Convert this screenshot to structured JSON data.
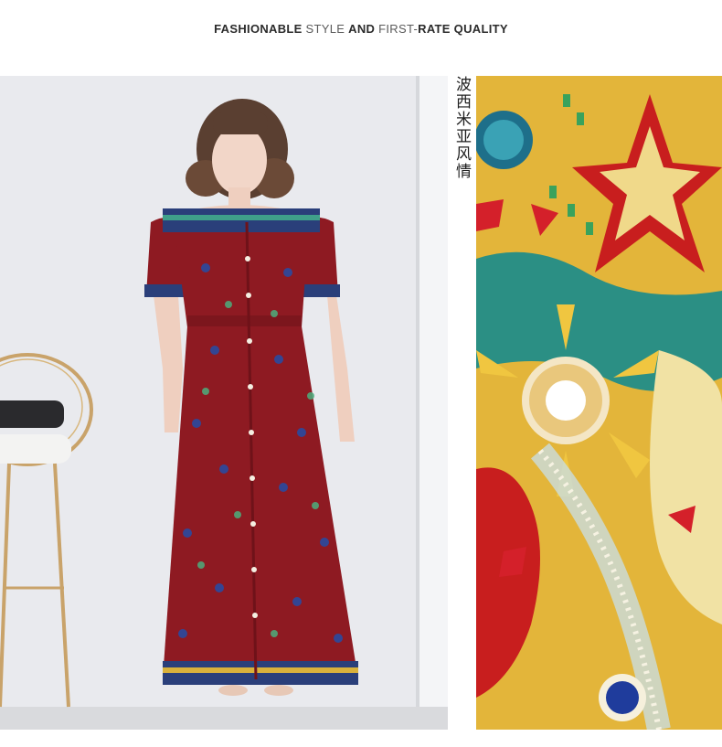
{
  "headline": {
    "part1": "FASHIONABLE",
    "part2": " STYLE ",
    "part3": "AND",
    "part4": " FIRST-",
    "part5": "RATE QUALITY"
  },
  "caption": "波西米亚风情",
  "images": {
    "left": "model-in-red-off-shoulder-maxi-dress",
    "right": "mosaic-tile-artwork"
  },
  "colors": {
    "dress_red": "#8e1a22",
    "dress_trim_blue": "#2a3f7a",
    "mosaic_gold": "#e3b53a",
    "mosaic_red": "#c81e1e",
    "mosaic_teal": "#2b8f84"
  }
}
